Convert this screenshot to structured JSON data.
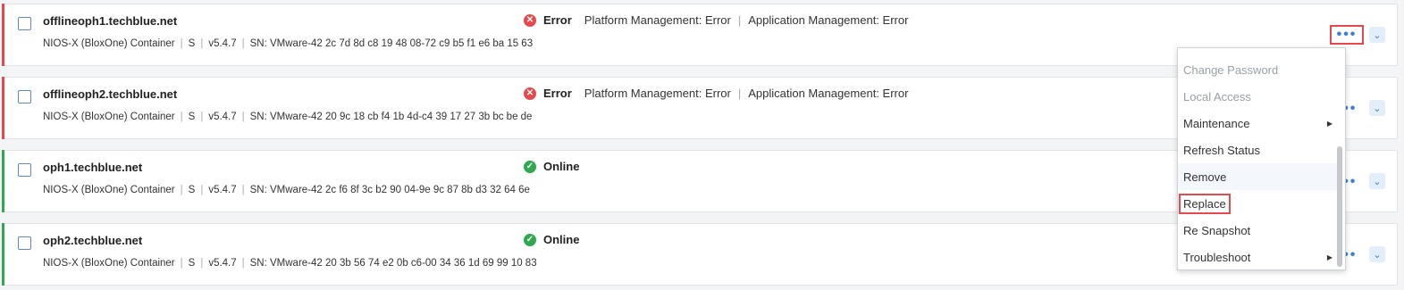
{
  "rows": [
    {
      "name": "offlineoph1.techblue.net",
      "type": "NIOS-X (BloxOne) Container",
      "size": "S",
      "version": "v5.4.7",
      "sn": "SN: VMware-42 2c 7d 8d c8 19 48 08-72 c9 b5 f1 e6 ba 15 63",
      "status": "Error",
      "platform_label": "Platform Management:",
      "platform_value": "Error",
      "app_label": "Application Management:",
      "app_value": "Error"
    },
    {
      "name": "offlineoph2.techblue.net",
      "type": "NIOS-X (BloxOne) Container",
      "size": "S",
      "version": "v5.4.7",
      "sn": "SN: VMware-42 20 9c 18 cb f4 1b 4d-c4 39 17 27 3b bc be de",
      "status": "Error",
      "platform_label": "Platform Management:",
      "platform_value": "Error",
      "app_label": "Application Management:",
      "app_value": "Error"
    },
    {
      "name": "oph1.techblue.net",
      "type": "NIOS-X (BloxOne) Container",
      "size": "S",
      "version": "v5.4.7",
      "sn": "SN: VMware-42 2c f6 8f 3c b2 90 04-9e 9c 87 8b d3 32 64 6e",
      "status": "Online"
    },
    {
      "name": "oph2.techblue.net",
      "type": "NIOS-X (BloxOne) Container",
      "size": "S",
      "version": "v5.4.7",
      "sn": "SN: VMware-42 20 3b 56 74 e2 0b c6-00 34 36 1d 69 99 10 83",
      "status": "Online"
    }
  ],
  "actions_icon": "more-horizontal-icon",
  "expand_icon": "chevron-down-icon",
  "menu": {
    "items": [
      {
        "label": "Change Password",
        "disabled": true
      },
      {
        "label": "Local Access",
        "disabled": true
      },
      {
        "label": "Maintenance",
        "submenu": true
      },
      {
        "label": "Refresh Status"
      },
      {
        "label": "Remove"
      },
      {
        "label": "Replace",
        "highlighted": true
      },
      {
        "label": "Re Snapshot"
      },
      {
        "label": "Troubleshoot",
        "submenu": true
      }
    ]
  },
  "colors": {
    "error": "#e5484d",
    "online": "#2fa84f",
    "accent": "#3a7fd6"
  }
}
